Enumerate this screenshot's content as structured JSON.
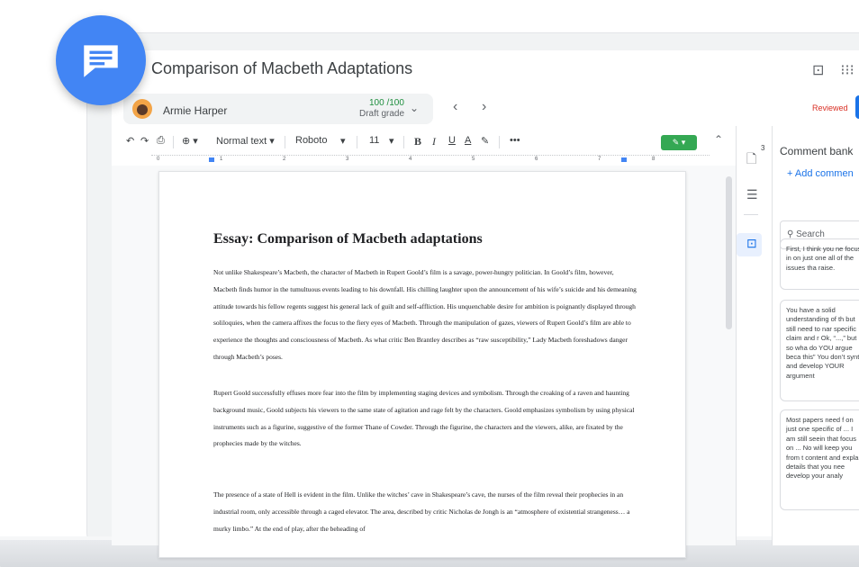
{
  "app_badge": {
    "icon": "message-icon",
    "color": "#4285f4"
  },
  "header": {
    "title": "Comparison of Macbeth Adaptations",
    "icons": [
      "comment-icon",
      "apps-grid-icon"
    ]
  },
  "student": {
    "name": "Armie Harper",
    "grade_value": "100 /100",
    "grade_label": "Draft grade",
    "status": "Reviewed"
  },
  "toolbar": {
    "undo": "↶",
    "redo": "↷",
    "print": "⎙",
    "zoom": "⊕ ▾",
    "style": "Normal text ▾",
    "font": "Roboto",
    "font_arrow": "▾",
    "size": "11",
    "size_arrow": "▾",
    "bold": "B",
    "italic": "I",
    "underline": "U",
    "text_color": "A",
    "highlight": "✎",
    "more": "•••",
    "mode": "✎ ▾"
  },
  "ruler": [
    "0",
    "1",
    "2",
    "3",
    "4",
    "5",
    "6",
    "7",
    "8"
  ],
  "document": {
    "heading": "Essay: Comparison of Macbeth adaptations",
    "paragraphs": [
      "Not unlike Shakespeare’s Macbeth, the character of Macbeth in Rupert Goold’s film is a savage, power-hungry politician. In Goold’s film, however, Macbeth finds humor in the tumultuous events leading to his downfall. His chilling laughter upon the announcement of his wife’s suicide and his demeaning attitude towards his fellow regents suggest his general lack of guilt and self-affliction. His unquenchable desire for ambition is poignantly displayed through soliloquies, when the camera affixes the focus to the fiery eyes of Macbeth. Through the manipulation of gazes, viewers of Rupert Goold’s film are able to experience the thoughts and consciousness of Macbeth. As what critic Ben Brantley describes as “raw susceptibility,” Lady Macbeth foreshadows danger through Macbeth’s poses.",
      "Rupert Goold successfully effuses more fear into the film by implementing staging devices and symbolism. Through the croaking of a raven and haunting background music, Goold subjects his viewers to the same state of agitation and rage felt by the characters. Goold emphasizes symbolism by using physical instruments such as a figurine, suggestive of the former Thane of Cowder. Through the figurine, the characters and the viewers, alike, are fixated by the prophecies made by the witches.",
      "The presence of a state of Hell is evident in the film. Unlike the witches’ cave in Shakespeare’s cave, the nurses of the film reveal their prophecies in an industrial room, only accessible through a caged elevator. The area, described by critic Nicholas de Jongh is an “atmosphere of existential strangeness… a murky limbo.” At the end of play, after the beheading of"
    ]
  },
  "rail": {
    "badge": "3",
    "icons": [
      "rubric-icon",
      "outline-icon",
      "comment-bank-icon"
    ]
  },
  "comment_bank": {
    "title": "Comment bank",
    "add_label": "+  Add commen",
    "search_placeholder": "Search",
    "cards": [
      "First, I think you ne focus in on just one all of the issues tha raise.",
      "You have a solid understanding of th but still need to nar specific claim and r Ok, “...,” but so wha do YOU argue beca this” You don’t synt and develop YOUR argument",
      "Most papers need f on just one specific of ... I am still seein that focus on ... No will keep you from t content and explan details that you nee develop your analy"
    ]
  }
}
